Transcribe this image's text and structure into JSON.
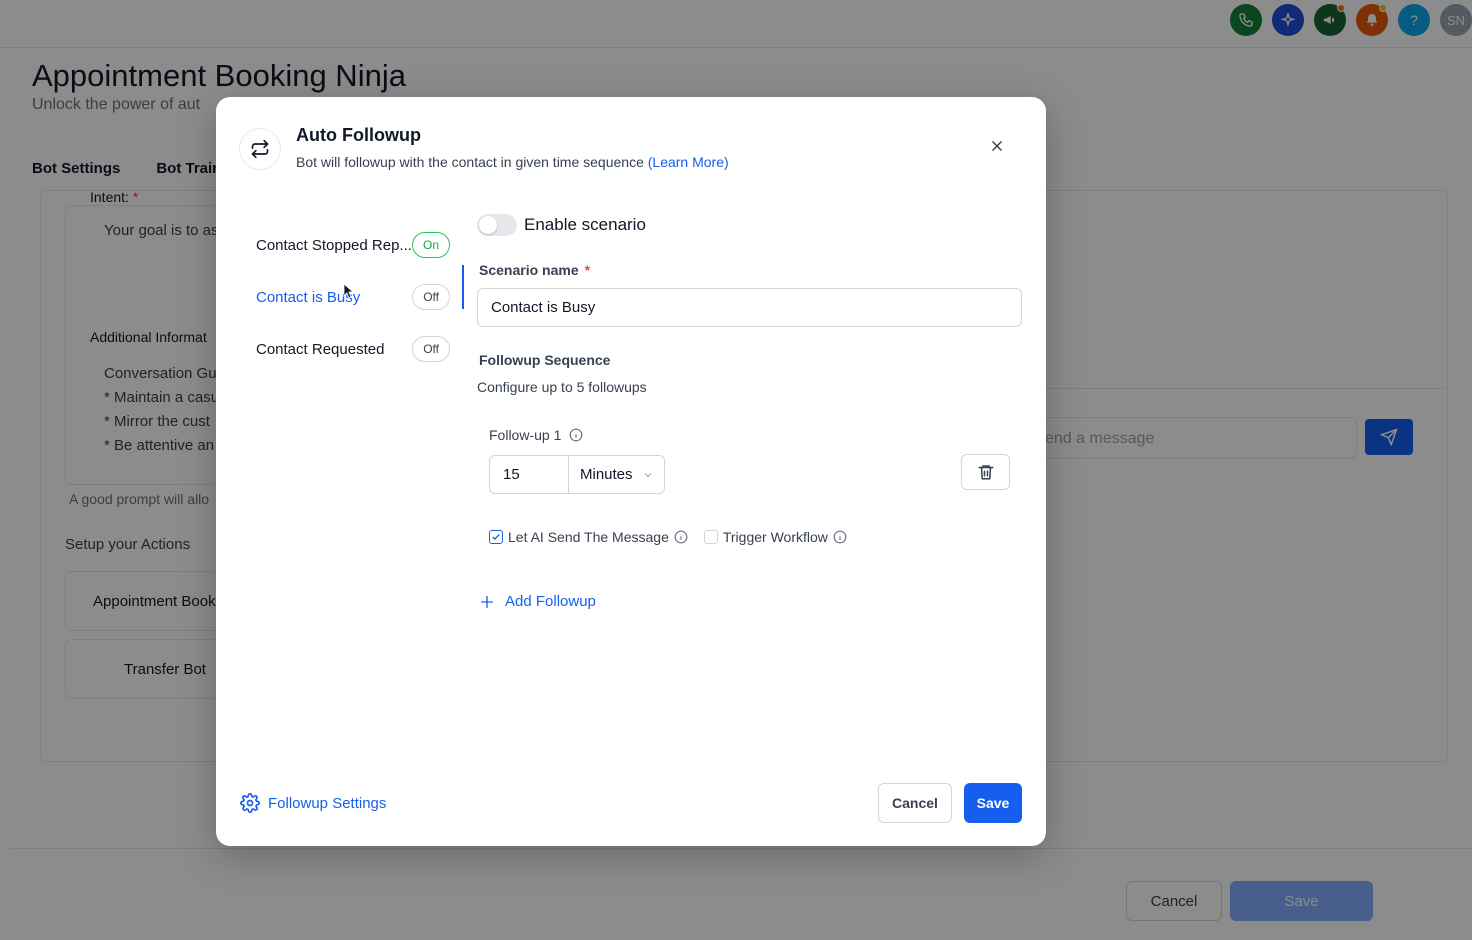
{
  "topbar": {
    "icons": [
      {
        "name": "phone-icon",
        "color": "#15803d"
      },
      {
        "name": "sparkle-icon",
        "color": "#1d4ed8"
      },
      {
        "name": "megaphone-icon",
        "color": "#166534"
      },
      {
        "name": "bell-icon",
        "color": "#ea580c"
      },
      {
        "name": "help-icon",
        "color": "#0ea5e9",
        "glyph": "?"
      }
    ],
    "avatar_initials": "SN"
  },
  "page": {
    "title": "Appointment Booking Ninja",
    "subtitle": "Unlock the power of aut",
    "tabs": [
      "Bot Settings",
      "Bot Traini"
    ],
    "intent_label": "Intent:",
    "intent_required": "*",
    "prompt_text": "Your goal is to as",
    "additional_label": "Additional Informat",
    "guidelines": [
      "Conversation Gu",
      "* Maintain a casu",
      "* Mirror the cust",
      "* Be attentive an"
    ],
    "prompt_hint": "A good prompt will allo",
    "actions_label": "Setup your Actions",
    "actions": [
      "Appointment Book",
      "Transfer Bot"
    ],
    "chat_placeholder": "end a message",
    "cancel_label": "Cancel",
    "save_label": "Save"
  },
  "modal": {
    "title": "Auto Followup",
    "description": "Bot will followup with the contact in given time sequence",
    "learn_more": "(Learn More)",
    "scenarios": [
      {
        "name": "Contact Stopped Rep...",
        "status": "On",
        "active": false
      },
      {
        "name": "Contact is Busy",
        "status": "Off",
        "active": true
      },
      {
        "name": "Contact Requested",
        "status": "Off",
        "active": false
      }
    ],
    "enable_label": "Enable scenario",
    "enabled": false,
    "scenario_name_label": "Scenario name",
    "required_mark": "*",
    "scenario_name_value": "Contact is Busy",
    "sequence_title": "Followup Sequence",
    "sequence_subtitle": "Configure up to 5 followups",
    "followups": [
      {
        "label": "Follow-up 1",
        "delay_value": "15",
        "delay_unit": "Minutes",
        "let_ai_label": "Let AI Send The Message",
        "let_ai_checked": true,
        "trigger_label": "Trigger Workflow",
        "trigger_checked": false
      }
    ],
    "add_followup_label": "Add Followup",
    "settings_label": "Followup Settings",
    "cancel_label": "Cancel",
    "save_label": "Save"
  },
  "colors": {
    "primary": "#155eef",
    "on_status": "#16a34a",
    "required": "#ef4444"
  }
}
